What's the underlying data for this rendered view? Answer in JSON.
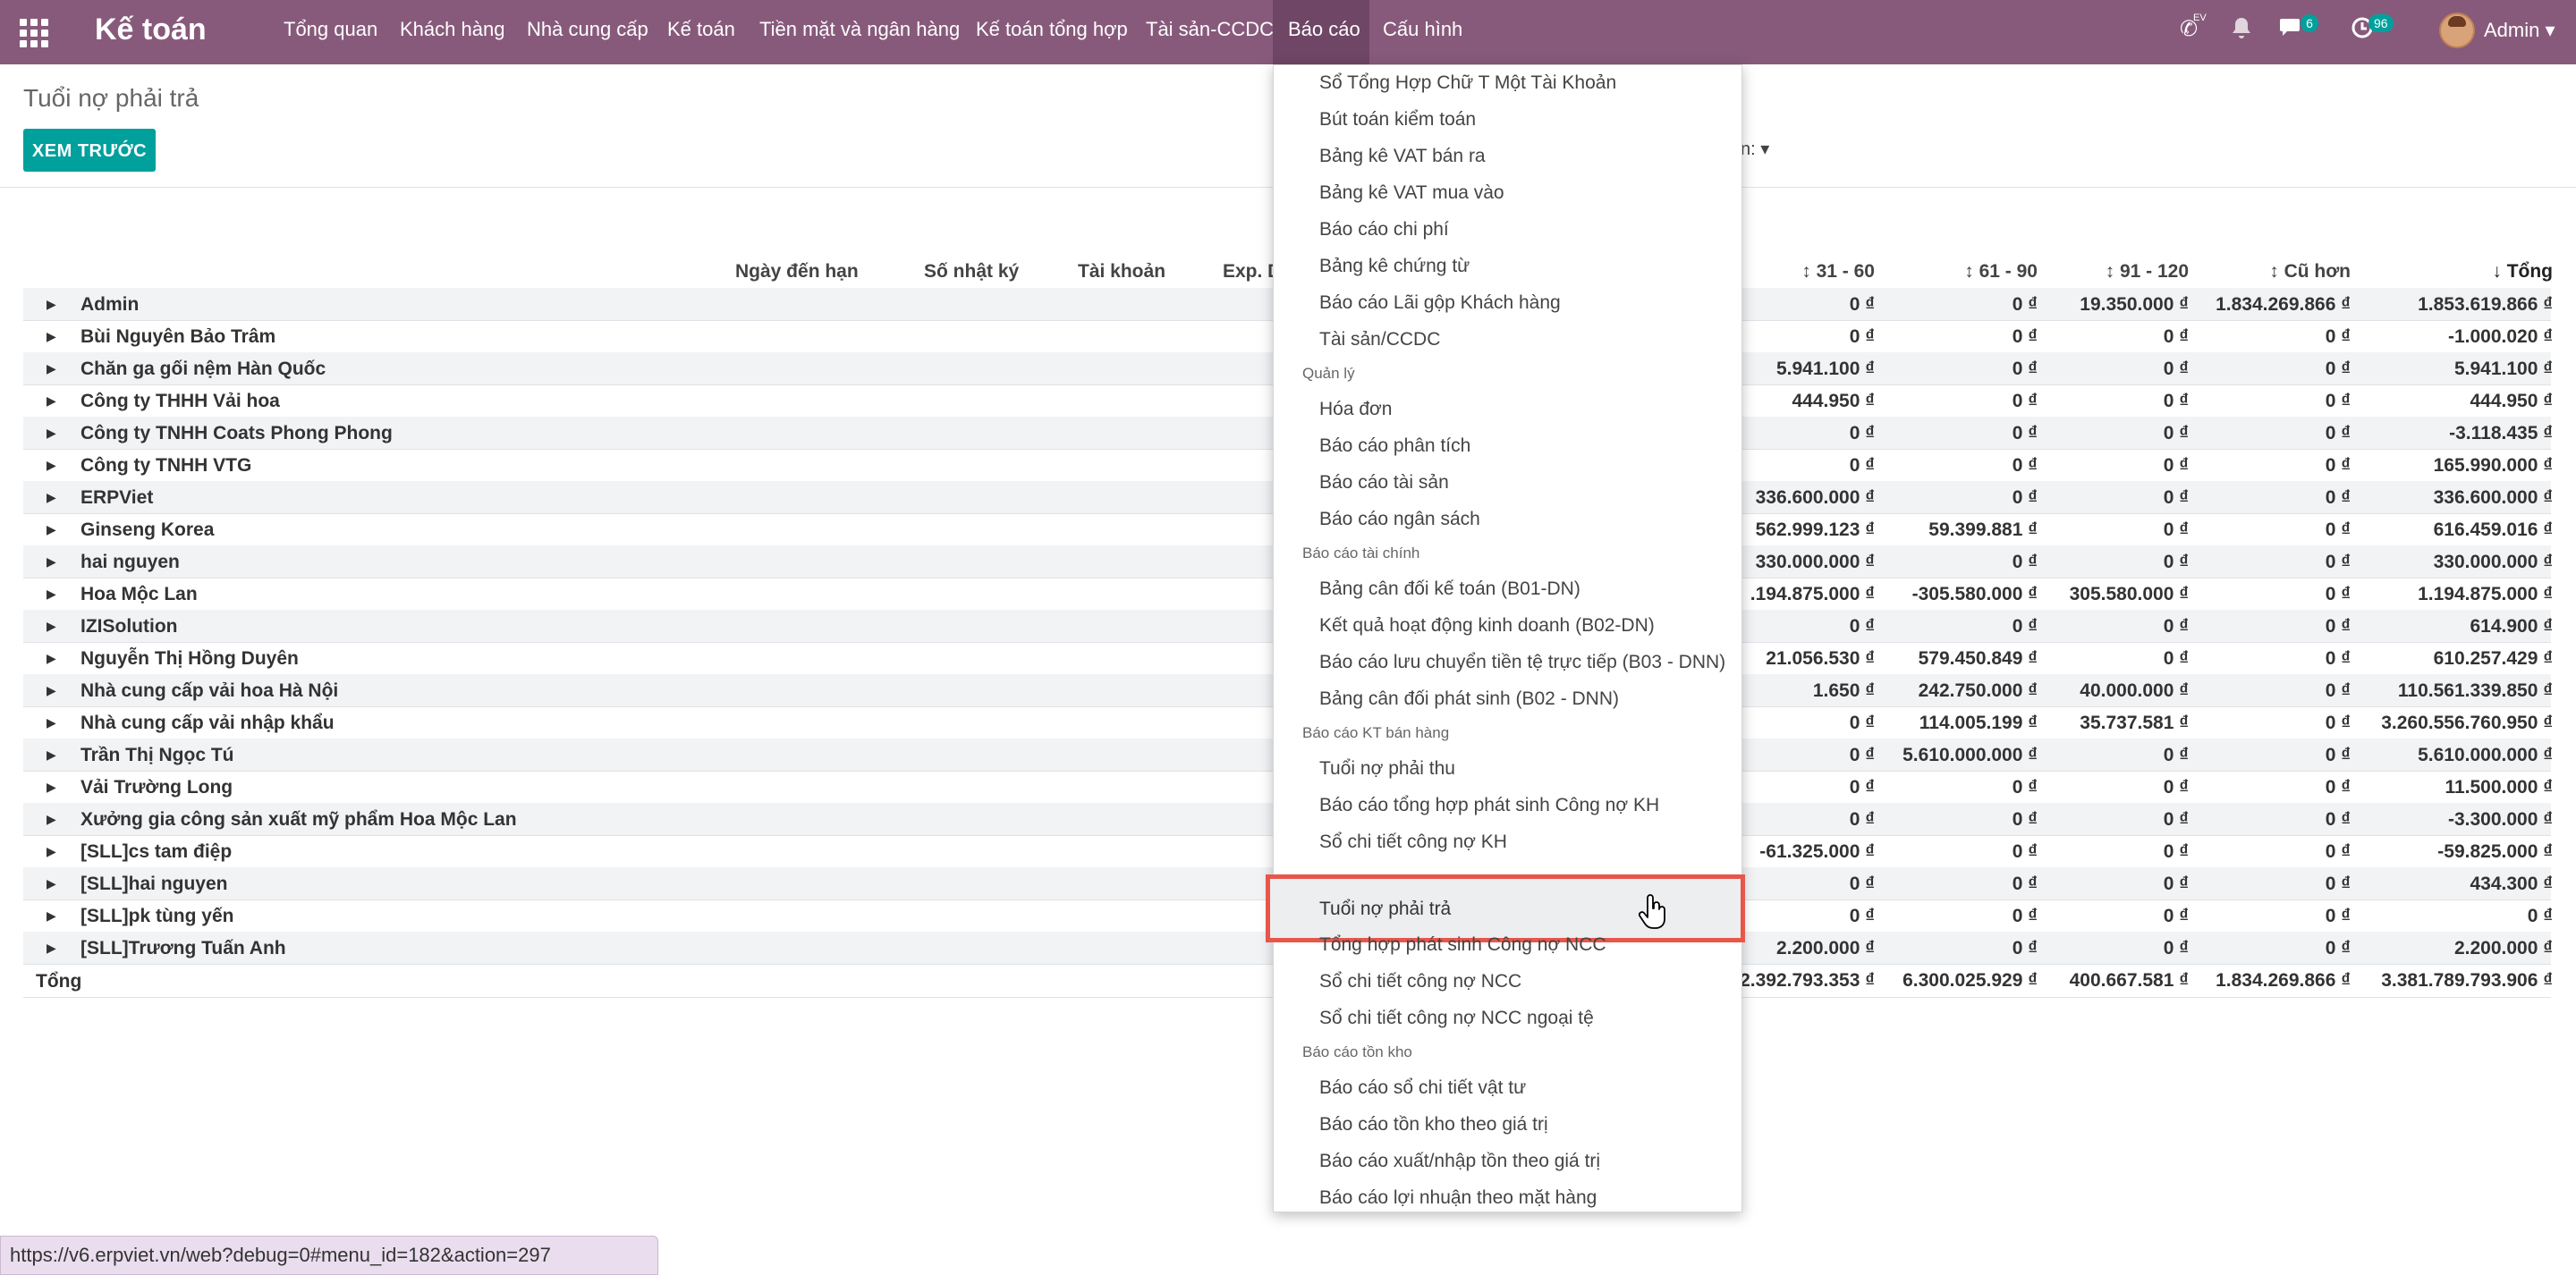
{
  "navbar": {
    "app_title": "Kế toán",
    "menu": [
      "Tổng quan",
      "Khách hàng",
      "Nhà cung cấp",
      "Kế toán",
      "Tiền mặt và ngân hàng",
      "Kế toán tổng hợp",
      "Tài sản-CCDC",
      "Báo cáo",
      "Cấu hình"
    ],
    "active_menu": "Báo cáo",
    "phone_badge": "EV",
    "messages_count": "6",
    "activities_count": "96",
    "user_name": "Admin"
  },
  "page": {
    "breadcrumb": "Tuổi nợ phải trả",
    "preview_button": "XEM TRƯỚC",
    "filter_fragment": "n:"
  },
  "table": {
    "headers": [
      "Ngày đến hạn",
      "Số nhật ký",
      "Tài khoản",
      "Exp. D",
      "31 - 60",
      "61 - 90",
      "91 - 120",
      "Cũ hơn",
      "Tổng"
    ],
    "rows": [
      {
        "partner": "Admin",
        "c1": "0 ₫",
        "c2": "0 ₫",
        "c3": "19.350.000 ₫",
        "c4": "1.834.269.866 ₫",
        "total": "1.853.619.866 ₫"
      },
      {
        "partner": "Bùi Nguyên Bảo Trâm",
        "c1": "0 ₫",
        "c2": "0 ₫",
        "c3": "0 ₫",
        "c4": "0 ₫",
        "total": "-1.000.020 ₫"
      },
      {
        "partner": "Chăn ga gối nệm Hàn Quốc",
        "c1": "5.941.100 ₫",
        "c2": "0 ₫",
        "c3": "0 ₫",
        "c4": "0 ₫",
        "total": "5.941.100 ₫"
      },
      {
        "partner": "Công ty THHH Vải hoa",
        "c1": "444.950 ₫",
        "c2": "0 ₫",
        "c3": "0 ₫",
        "c4": "0 ₫",
        "total": "444.950 ₫"
      },
      {
        "partner": "Công ty TNHH Coats Phong Phong",
        "c1": "0 ₫",
        "c2": "0 ₫",
        "c3": "0 ₫",
        "c4": "0 ₫",
        "total": "-3.118.435 ₫"
      },
      {
        "partner": "Công ty TNHH VTG",
        "c1": "0 ₫",
        "c2": "0 ₫",
        "c3": "0 ₫",
        "c4": "0 ₫",
        "total": "165.990.000 ₫"
      },
      {
        "partner": "ERPViet",
        "c1": "336.600.000 ₫",
        "c2": "0 ₫",
        "c3": "0 ₫",
        "c4": "0 ₫",
        "total": "336.600.000 ₫"
      },
      {
        "partner": "Ginseng Korea",
        "c1": "562.999.123 ₫",
        "c2": "59.399.881 ₫",
        "c3": "0 ₫",
        "c4": "0 ₫",
        "total": "616.459.016 ₫"
      },
      {
        "partner": "hai nguyen",
        "c1": "330.000.000 ₫",
        "c2": "0 ₫",
        "c3": "0 ₫",
        "c4": "0 ₫",
        "total": "330.000.000 ₫"
      },
      {
        "partner": "Hoa Mộc Lan",
        "c1": ".194.875.000 ₫",
        "c2": "-305.580.000 ₫",
        "c3": "305.580.000 ₫",
        "c4": "0 ₫",
        "total": "1.194.875.000 ₫"
      },
      {
        "partner": "IZISolution",
        "c1": "0 ₫",
        "c2": "0 ₫",
        "c3": "0 ₫",
        "c4": "0 ₫",
        "total": "614.900 ₫"
      },
      {
        "partner": "Nguyễn Thị Hồng Duyên",
        "c1": "21.056.530 ₫",
        "c2": "579.450.849 ₫",
        "c3": "0 ₫",
        "c4": "0 ₫",
        "total": "610.257.429 ₫"
      },
      {
        "partner": "Nhà cung cấp vải hoa Hà Nội",
        "c1": "1.650 ₫",
        "c2": "242.750.000 ₫",
        "c3": "40.000.000 ₫",
        "c4": "0 ₫",
        "total": "110.561.339.850 ₫"
      },
      {
        "partner": "Nhà cung cấp vải nhập khẩu",
        "c1": "0 ₫",
        "c2": "114.005.199 ₫",
        "c3": "35.737.581 ₫",
        "c4": "0 ₫",
        "total": "3.260.556.760.950 ₫"
      },
      {
        "partner": "Trần Thị Ngọc Tú",
        "c1": "0 ₫",
        "c2": "5.610.000.000 ₫",
        "c3": "0 ₫",
        "c4": "0 ₫",
        "total": "5.610.000.000 ₫"
      },
      {
        "partner": "Vải Trường Long",
        "c1": "0 ₫",
        "c2": "0 ₫",
        "c3": "0 ₫",
        "c4": "0 ₫",
        "total": "11.500.000 ₫"
      },
      {
        "partner": "Xưởng gia công sản xuất mỹ phẩm Hoa Mộc Lan",
        "c1": "0 ₫",
        "c2": "0 ₫",
        "c3": "0 ₫",
        "c4": "0 ₫",
        "total": "-3.300.000 ₫"
      },
      {
        "partner": "[SLL]cs tam điệp",
        "c1": "-61.325.000 ₫",
        "c2": "0 ₫",
        "c3": "0 ₫",
        "c4": "0 ₫",
        "total": "-59.825.000 ₫"
      },
      {
        "partner": "[SLL]hai nguyen",
        "c1": "0 ₫",
        "c2": "0 ₫",
        "c3": "0 ₫",
        "c4": "0 ₫",
        "total": "434.300 ₫"
      },
      {
        "partner": "[SLL]pk tùng yến",
        "c1": "0 ₫",
        "c2": "0 ₫",
        "c3": "0 ₫",
        "c4": "0 ₫",
        "total": "0 ₫"
      },
      {
        "partner": "[SLL]Trương Tuấn Anh",
        "c1": "2.200.000 ₫",
        "c2": "0 ₫",
        "c3": "0 ₫",
        "c4": "0 ₫",
        "total": "2.200.000 ₫"
      }
    ],
    "total": {
      "label": "Tổng",
      "c1": "2.392.793.353 ₫",
      "c2": "6.300.025.929 ₫",
      "c3": "400.667.581 ₫",
      "c4": "1.834.269.866 ₫",
      "total": "3.381.789.793.906 ₫"
    }
  },
  "dropdown": {
    "entries": [
      {
        "type": "item",
        "label": "Sổ Tổng Hợp Chữ T Một Tài Khoản"
      },
      {
        "type": "item",
        "label": "Bút toán kiểm toán"
      },
      {
        "type": "item",
        "label": "Bảng kê VAT bán ra"
      },
      {
        "type": "item",
        "label": "Bảng kê VAT mua vào"
      },
      {
        "type": "item",
        "label": "Báo cáo chi phí"
      },
      {
        "type": "item",
        "label": "Bảng kê chứng từ"
      },
      {
        "type": "item",
        "label": "Báo cáo Lãi gộp Khách hàng"
      },
      {
        "type": "item",
        "label": "Tài sản/CCDC"
      },
      {
        "type": "header",
        "label": "Quản lý"
      },
      {
        "type": "item",
        "label": "Hóa đơn"
      },
      {
        "type": "item",
        "label": "Báo cáo phân tích"
      },
      {
        "type": "item",
        "label": "Báo cáo tài sản"
      },
      {
        "type": "item",
        "label": "Báo cáo ngân sách"
      },
      {
        "type": "header",
        "label": "Báo cáo tài chính"
      },
      {
        "type": "item",
        "label": "Bảng cân đối kế toán (B01-DN)"
      },
      {
        "type": "item",
        "label": "Kết quả hoạt động kinh doanh (B02-DN)"
      },
      {
        "type": "item",
        "label": "Báo cáo lưu chuyển tiền tệ trực tiếp (B03 - DNN)"
      },
      {
        "type": "item",
        "label": "Bảng cân đối phát sinh (B02 - DNN)"
      },
      {
        "type": "header",
        "label": "Báo cáo KT bán hàng"
      },
      {
        "type": "item",
        "label": "Tuổi nợ phải thu"
      },
      {
        "type": "item",
        "label": "Báo cáo tổng hợp phát sinh Công nợ KH"
      },
      {
        "type": "item",
        "label": "Sổ chi tiết công nợ KH"
      },
      {
        "type": "item",
        "label": "Tuổi nợ phải trả",
        "highlighted": true
      },
      {
        "type": "item",
        "label": "Tổng hợp phát sinh Công nợ NCC"
      },
      {
        "type": "item",
        "label": "Sổ chi tiết công nợ NCC"
      },
      {
        "type": "item",
        "label": "Sổ chi tiết công nợ NCC ngoại tệ"
      },
      {
        "type": "header",
        "label": "Báo cáo tồn kho"
      },
      {
        "type": "item",
        "label": "Báo cáo sổ chi tiết vật tư"
      },
      {
        "type": "item",
        "label": "Báo cáo tồn kho theo giá trị"
      },
      {
        "type": "item",
        "label": "Báo cáo xuất/nhập tồn theo giá trị"
      },
      {
        "type": "item",
        "label": "Báo cáo lợi nhuận theo mặt hàng"
      }
    ]
  },
  "status_bar": {
    "url": "https://v6.erpviet.vn/web?debug=0#menu_id=182&action=297"
  },
  "colors": {
    "brand": "#875a7b",
    "accent": "#00a09d",
    "highlight_border": "#e8564a"
  }
}
